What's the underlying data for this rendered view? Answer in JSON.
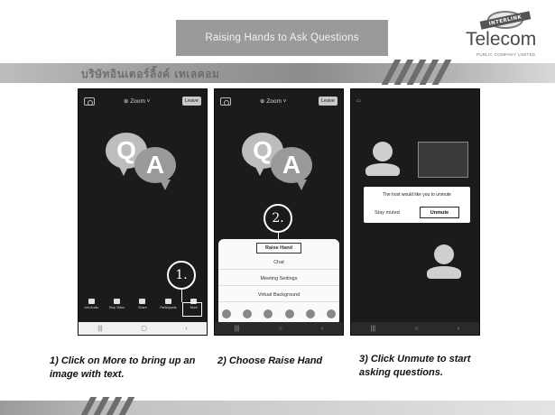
{
  "header": {
    "title": "Raising Hands to Ask Questions",
    "logo_word": "Telecom",
    "logo_ribbon": "INTERLINK",
    "logo_sub": "PUBLIC COMPANY LIMITED",
    "band_text": "บริษัทอินเตอร์ลิ้งค์ เทเลคอม"
  },
  "phone1": {
    "zoom_label": "⊕ Zoom ˅",
    "leave_label": "Leave",
    "bubble_q": "Q",
    "bubble_a": "A",
    "step_label": "1.",
    "controls": [
      {
        "label": "Join Audio"
      },
      {
        "label": "Stop Video"
      },
      {
        "label": "Share"
      },
      {
        "label": "Participants"
      },
      {
        "label": "More"
      }
    ],
    "nav": [
      "|||",
      "▢",
      "‹"
    ]
  },
  "phone2": {
    "zoom_label": "⊕ Zoom ˅",
    "leave_label": "Leave",
    "bubble_q": "Q",
    "bubble_a": "A",
    "step_label": "2.",
    "sheet_items": [
      "Raise Hand",
      "Chat",
      "Meeting Settings",
      "Virtual Background"
    ],
    "nav": [
      "|||",
      "○",
      "‹"
    ]
  },
  "phone3": {
    "dialog_message": "The host would like you to unmute",
    "stay_muted": "Stay muted",
    "unmute": "Unmute",
    "nav": [
      "|||",
      "○",
      "‹"
    ]
  },
  "captions": {
    "step1_line1": "1) Click on More to bring up an",
    "step1_line2": "image with text.",
    "step2": "2) Choose Raise Hand",
    "step3_line1": "3) Click Unmute to start",
    "step3_line2": "asking questions."
  },
  "colors": {
    "title_box": "#9a9a9a",
    "phone_bg": "#1b1b1b",
    "band": "#8c8c8c"
  }
}
